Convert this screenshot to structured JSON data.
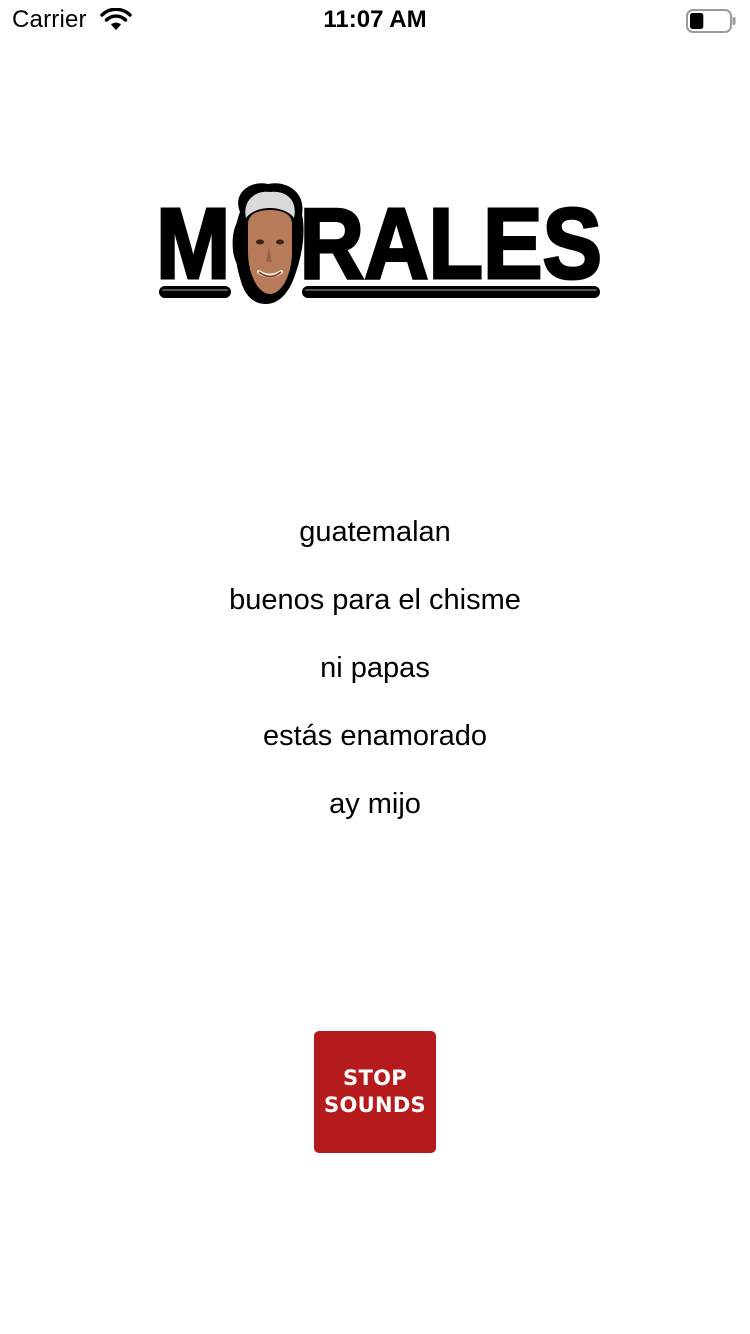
{
  "status_bar": {
    "carrier": "Carrier",
    "time": "11:07 AM",
    "battery_level": 0.35,
    "wifi_icon": "wifi-icon",
    "battery_icon": "battery-icon"
  },
  "logo": {
    "text": "MORALES",
    "icon": "portrait-logo"
  },
  "phrases": [
    {
      "label": "guatemalan"
    },
    {
      "label": "buenos para el chisme"
    },
    {
      "label": "ni papas"
    },
    {
      "label": "estás enamorado"
    },
    {
      "label": "ay mijo"
    }
  ],
  "stop_button": {
    "line1": "STOP",
    "line2": "SOUNDS",
    "color": "#b51b1c"
  }
}
